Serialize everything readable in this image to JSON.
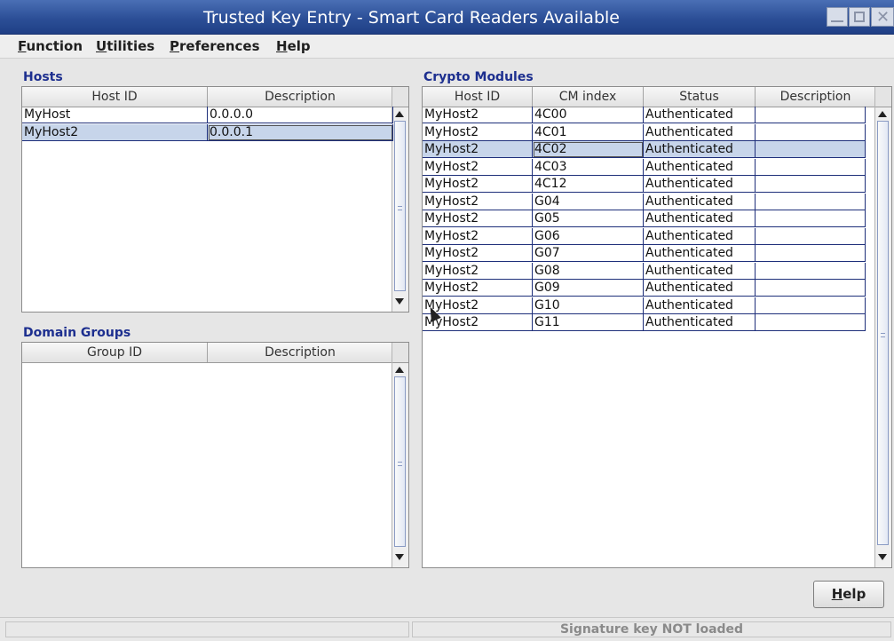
{
  "window": {
    "title": "Trusted Key Entry  - Smart Card Readers Available",
    "controls": [
      "minimize-icon",
      "maximize-icon",
      "close-icon"
    ]
  },
  "menubar": {
    "items": [
      {
        "label": "Function",
        "mnemonic": "F"
      },
      {
        "label": "Utilities",
        "mnemonic": "U"
      },
      {
        "label": "Preferences",
        "mnemonic": "P"
      },
      {
        "label": "Help",
        "mnemonic": "H"
      }
    ]
  },
  "hosts": {
    "title": "Hosts",
    "columns": [
      "Host ID",
      "Description"
    ],
    "rows": [
      [
        "MyHost",
        "0.0.0.0"
      ],
      [
        "MyHost2",
        "0.0.0.1"
      ]
    ],
    "selected_row": 1
  },
  "domain_groups": {
    "title": "Domain Groups",
    "columns": [
      "Group ID",
      "Description"
    ],
    "rows": []
  },
  "crypto_modules": {
    "title": "Crypto Modules",
    "columns": [
      "Host ID",
      "CM index",
      "Status",
      "Description"
    ],
    "rows": [
      [
        "MyHost2",
        "4C00",
        "Authenticated",
        ""
      ],
      [
        "MyHost2",
        "4C01",
        "Authenticated",
        ""
      ],
      [
        "MyHost2",
        "4C02",
        "Authenticated",
        ""
      ],
      [
        "MyHost2",
        "4C03",
        "Authenticated",
        ""
      ],
      [
        "MyHost2",
        "4C12",
        "Authenticated",
        ""
      ],
      [
        "MyHost2",
        "G04",
        "Authenticated",
        ""
      ],
      [
        "MyHost2",
        "G05",
        "Authenticated",
        ""
      ],
      [
        "MyHost2",
        "G06",
        "Authenticated",
        ""
      ],
      [
        "MyHost2",
        "G07",
        "Authenticated",
        ""
      ],
      [
        "MyHost2",
        "G08",
        "Authenticated",
        ""
      ],
      [
        "MyHost2",
        "G09",
        "Authenticated",
        ""
      ],
      [
        "MyHost2",
        "G10",
        "Authenticated",
        ""
      ],
      [
        "MyHost2",
        "G11",
        "Authenticated",
        ""
      ]
    ],
    "selected_row": 2
  },
  "footer": {
    "help_button": {
      "label": "Help",
      "mnemonic": "H"
    },
    "status_left": "",
    "status_right": "Signature key NOT loaded"
  },
  "colors": {
    "titlebar": "#2c4f97",
    "section_title": "#1d2f8f",
    "selection": "#c7d5ea",
    "grid_lines": "#1e2f7a",
    "status_text": "#8a8a8a"
  }
}
